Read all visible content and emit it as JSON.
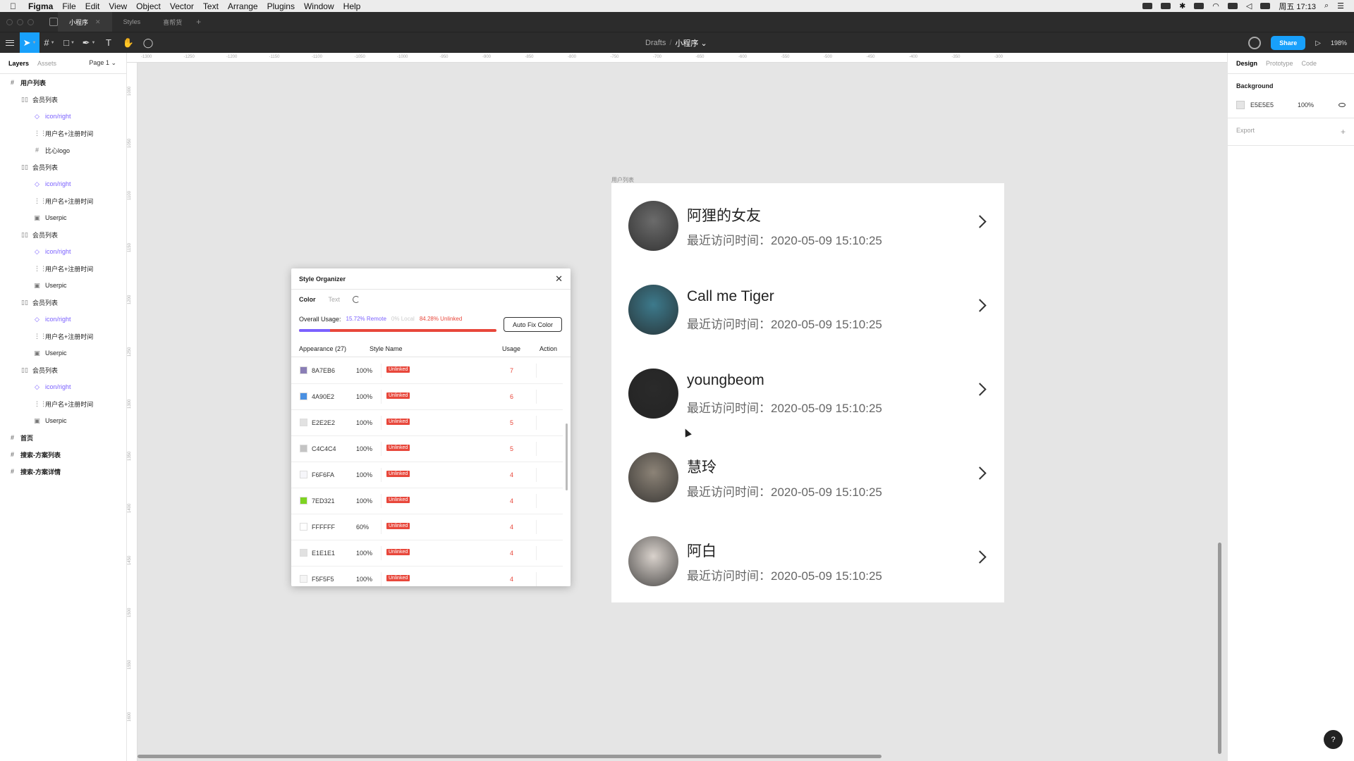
{
  "menubar": {
    "app": "Figma",
    "items": [
      "File",
      "Edit",
      "View",
      "Object",
      "Vector",
      "Text",
      "Arrange",
      "Plugins",
      "Window",
      "Help"
    ],
    "clock": "周五 17:13"
  },
  "tabs": [
    {
      "label": "小程序"
    },
    {
      "label": "Styles"
    },
    {
      "label": "喜帮货"
    }
  ],
  "toolbar": {
    "breadcrumb_drafts": "Drafts",
    "breadcrumb_sep": "/",
    "file_name": "小程序 ⌄",
    "share_label": "Share",
    "zoom": "198%"
  },
  "left_panel": {
    "tab_layers": "Layers",
    "tab_assets": "Assets",
    "page": "Page 1 ⌄",
    "layers": [
      {
        "label": "用户列表",
        "level": 0,
        "icon": "#",
        "comp": false
      },
      {
        "label": "会员列表",
        "level": 1,
        "icon": "▯▯",
        "comp": false
      },
      {
        "label": "icon/right",
        "level": 2,
        "icon": "◇",
        "comp": true
      },
      {
        "label": "用户名+注册时间",
        "level": 2,
        "icon": "⋮⋮",
        "comp": false
      },
      {
        "label": "比心logo",
        "level": 2,
        "icon": "#",
        "comp": false
      },
      {
        "label": "会员列表",
        "level": 1,
        "icon": "▯▯",
        "comp": false
      },
      {
        "label": "icon/right",
        "level": 2,
        "icon": "◇",
        "comp": true
      },
      {
        "label": "用户名+注册时间",
        "level": 2,
        "icon": "⋮⋮",
        "comp": false
      },
      {
        "label": "Userpic",
        "level": 2,
        "icon": "▣",
        "comp": false
      },
      {
        "label": "会员列表",
        "level": 1,
        "icon": "▯▯",
        "comp": false
      },
      {
        "label": "icon/right",
        "level": 2,
        "icon": "◇",
        "comp": true
      },
      {
        "label": "用户名+注册时间",
        "level": 2,
        "icon": "⋮⋮",
        "comp": false
      },
      {
        "label": "Userpic",
        "level": 2,
        "icon": "▣",
        "comp": false
      },
      {
        "label": "会员列表",
        "level": 1,
        "icon": "▯▯",
        "comp": false
      },
      {
        "label": "icon/right",
        "level": 2,
        "icon": "◇",
        "comp": true
      },
      {
        "label": "用户名+注册时间",
        "level": 2,
        "icon": "⋮⋮",
        "comp": false
      },
      {
        "label": "Userpic",
        "level": 2,
        "icon": "▣",
        "comp": false
      },
      {
        "label": "会员列表",
        "level": 1,
        "icon": "▯▯",
        "comp": false
      },
      {
        "label": "icon/right",
        "level": 2,
        "icon": "◇",
        "comp": true
      },
      {
        "label": "用户名+注册时间",
        "level": 2,
        "icon": "⋮⋮",
        "comp": false
      },
      {
        "label": "Userpic",
        "level": 2,
        "icon": "▣",
        "comp": false
      },
      {
        "label": "首页",
        "level": 0,
        "icon": "#",
        "comp": false
      },
      {
        "label": "搜索-方案列表",
        "level": 0,
        "icon": "#",
        "comp": false
      },
      {
        "label": "搜索-方案详情",
        "level": 0,
        "icon": "#",
        "comp": false
      }
    ]
  },
  "rulers": {
    "top": [
      "-1300",
      "-1250",
      "-1200",
      "-1150",
      "-1100",
      "-1050",
      "-1000",
      "-950",
      "-900",
      "-850",
      "-800",
      "-750",
      "-700",
      "-650",
      "-600",
      "-550",
      "-500",
      "-450",
      "-400",
      "-350",
      "-300"
    ],
    "left": [
      "1000",
      "1050",
      "1100",
      "1150",
      "1200",
      "1250",
      "1300",
      "1350",
      "1400",
      "1450",
      "1500",
      "1550",
      "1600"
    ]
  },
  "frame": {
    "label": "用户列表",
    "users": [
      {
        "name": "阿狸的女友",
        "time": "最近访问时间：2020-05-09 15:10:25",
        "avatar_color": "#6b6b6b"
      },
      {
        "name": "Call me Tiger",
        "time": "最近访问时间：2020-05-09 15:10:25",
        "avatar_color": "#3d7a8c"
      },
      {
        "name": "youngbeom",
        "time": "最近访问时间：2020-05-09 15:10:25",
        "avatar_color": "#2a2a2a"
      },
      {
        "name": "慧玲",
        "time": "最近访问时间：2020-05-09 15:10:25",
        "avatar_color": "#8c8377"
      },
      {
        "name": "阿白",
        "time": "最近访问时间：2020-05-09 15:10:25",
        "avatar_color": "#d9d2cc"
      }
    ]
  },
  "plugin": {
    "title": "Style Organizer",
    "tab_color": "Color",
    "tab_text": "Text",
    "usage_label": "Overall Usage:",
    "usage_remote": "15.72% Remote",
    "usage_local": "0% Local",
    "usage_unlinked": "84.28% Unlinked",
    "remote_fraction": 0.1572,
    "autofix_label": "Auto Fix Color",
    "headers": {
      "appearance": "Appearance (27)",
      "style_name": "Style Name",
      "usage": "Usage",
      "action": "Action"
    },
    "rows": [
      {
        "hex": "8A7EB6",
        "opacity": "100%",
        "status": "Unlinked",
        "usage": "7",
        "color": "#8a7eb6"
      },
      {
        "hex": "4A90E2",
        "opacity": "100%",
        "status": "Unlinked",
        "usage": "6",
        "color": "#4a90e2"
      },
      {
        "hex": "E2E2E2",
        "opacity": "100%",
        "status": "Unlinked",
        "usage": "5",
        "color": "#e2e2e2"
      },
      {
        "hex": "C4C4C4",
        "opacity": "100%",
        "status": "Unlinked",
        "usage": "5",
        "color": "#c4c4c4"
      },
      {
        "hex": "F6F6FA",
        "opacity": "100%",
        "status": "Unlinked",
        "usage": "4",
        "color": "#f6f6fa"
      },
      {
        "hex": "7ED321",
        "opacity": "100%",
        "status": "Unlinked",
        "usage": "4",
        "color": "#7ed321"
      },
      {
        "hex": "FFFFFF",
        "opacity": "60%",
        "status": "Unlinked",
        "usage": "4",
        "color": "#ffffff"
      },
      {
        "hex": "E1E1E1",
        "opacity": "100%",
        "status": "Unlinked",
        "usage": "4",
        "color": "#e1e1e1"
      },
      {
        "hex": "F5F5F5",
        "opacity": "100%",
        "status": "Unlinked",
        "usage": "4",
        "color": "#f5f5f5"
      }
    ]
  },
  "right_panel": {
    "tab_design": "Design",
    "tab_prototype": "Prototype",
    "tab_code": "Code",
    "background_label": "Background",
    "bg_hex": "E5E5E5",
    "bg_opacity": "100%",
    "export_label": "Export",
    "export_plus": "+"
  },
  "help_label": "?"
}
